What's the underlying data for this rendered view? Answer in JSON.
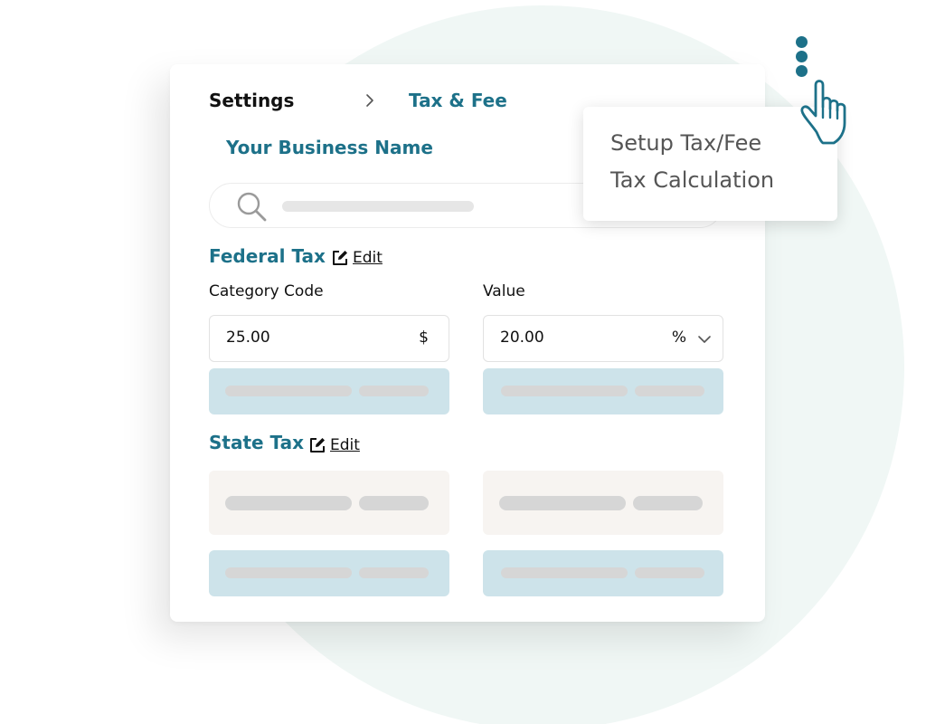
{
  "breadcrumb": {
    "root": "Settings",
    "current": "Tax & Fee"
  },
  "business_name": "Your Business Name",
  "federal_tax": {
    "title": "Federal Tax",
    "edit_label": "Edit",
    "category_code_label": "Category Code",
    "category_code_value": "25.00",
    "category_code_unit": "$",
    "value_label": "Value",
    "value_value": "20.00",
    "value_unit": "%"
  },
  "state_tax": {
    "title": "State Tax",
    "edit_label": "Edit"
  },
  "menu": {
    "items": [
      "Setup Tax/Fee",
      "Tax Calculation"
    ]
  },
  "icons": {
    "search": "search-icon",
    "edit": "edit-icon",
    "chevron": "chevron-right-icon",
    "dropdown": "chevron-down-icon",
    "more": "more-vertical-icon",
    "pointer": "hand-pointer-icon"
  },
  "colors": {
    "accent": "#1d7189",
    "placeholder_blue": "#cde3ea",
    "placeholder_beige": "#f7f4f1",
    "background_circle": "#f0f7f5"
  }
}
